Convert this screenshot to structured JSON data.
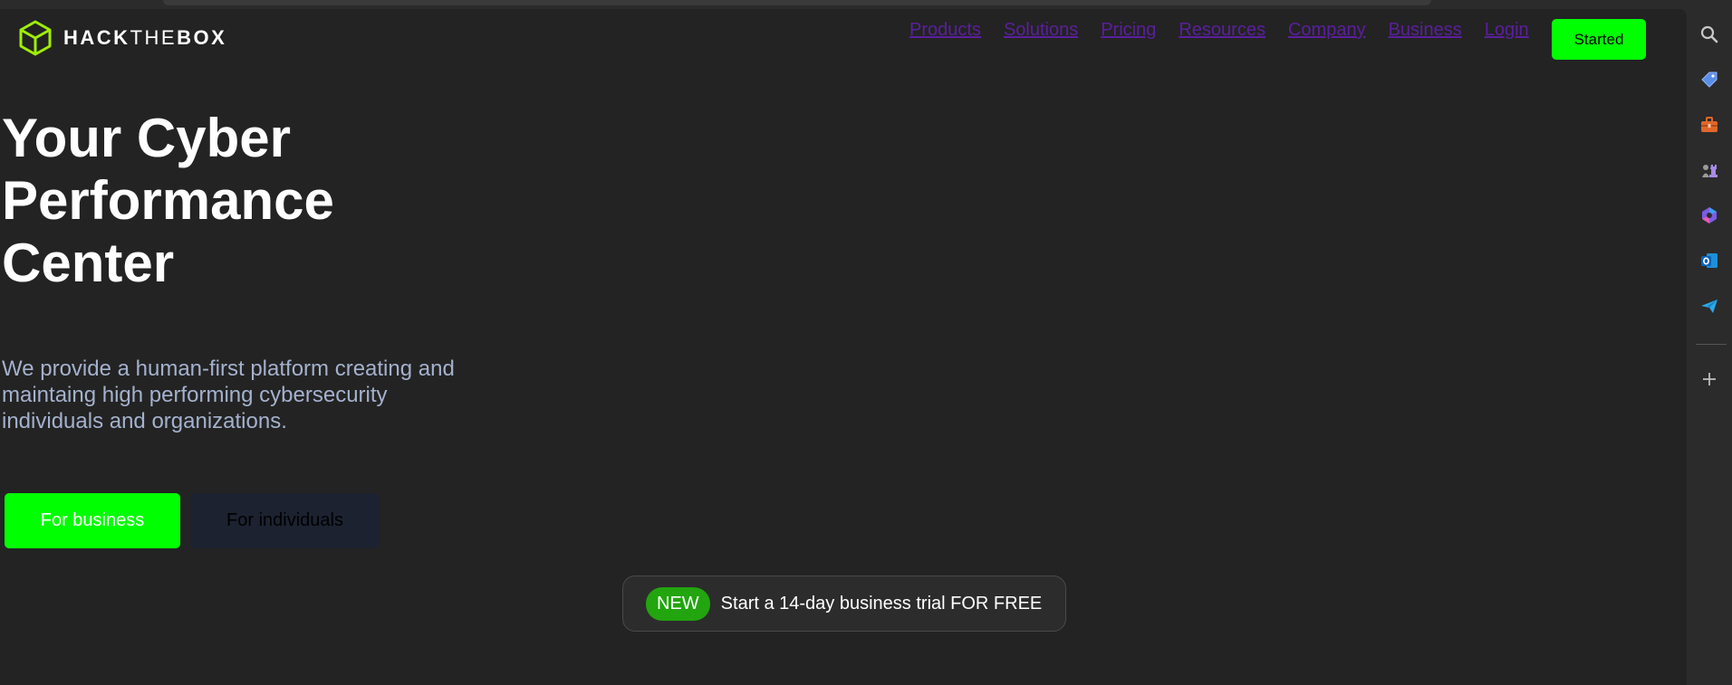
{
  "brand": {
    "part1": "HACK",
    "part2": "THE",
    "part3": "BOX"
  },
  "nav": {
    "items": [
      "Products",
      "Solutions",
      "Pricing",
      "Resources",
      "Company",
      "Business",
      "Login"
    ],
    "cta_label": "Started"
  },
  "hero": {
    "title": "Your Cyber Performance Center",
    "subtitle": "We provide a human-first platform creating and maintaing high performing cybersecurity individuals and organizations.",
    "primary_button": "For business",
    "secondary_button": "For individuals"
  },
  "promo": {
    "badge": "NEW",
    "text": "Start a 14-day business trial FOR FREE"
  },
  "sidebar": {
    "icons": [
      "search-icon",
      "tag-icon",
      "toolbox-icon",
      "chess-icon",
      "copilot-icon",
      "outlook-icon",
      "send-icon",
      "add-icon"
    ]
  },
  "colors": {
    "page_bg": "#232323",
    "accent_green": "#00ff00",
    "badge_green": "#22a50e",
    "nav_link": "#5b1f9e",
    "subtitle": "#a4b1cd",
    "individuals_bg": "#1c2230",
    "logo_green": "#9fef00"
  }
}
